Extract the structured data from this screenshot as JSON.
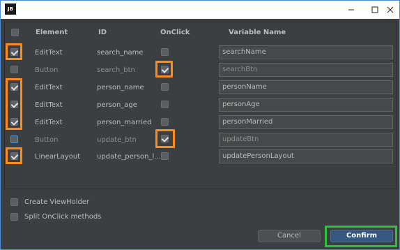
{
  "titlebar": {
    "app_icon_text": "JB",
    "minimize": "minimize",
    "maximize": "maximize",
    "close": "close"
  },
  "table": {
    "headers": {
      "element": "Element",
      "id": "ID",
      "onclick": "OnClick",
      "variable": "Variable Name"
    },
    "rows": [
      {
        "element": "EditText",
        "id": "search_name",
        "variable": "searchName",
        "checked": true,
        "onclick": false,
        "enabled": true
      },
      {
        "element": "Button",
        "id": "search_btn",
        "variable": "searchBtn",
        "checked": false,
        "onclick": true,
        "enabled": false
      },
      {
        "element": "EditText",
        "id": "person_name",
        "variable": "personName",
        "checked": true,
        "onclick": false,
        "enabled": true
      },
      {
        "element": "EditText",
        "id": "person_age",
        "variable": "personAge",
        "checked": true,
        "onclick": false,
        "enabled": true
      },
      {
        "element": "EditText",
        "id": "person_married",
        "variable": "personMarried",
        "checked": true,
        "onclick": false,
        "enabled": true
      },
      {
        "element": "Button",
        "id": "update_btn",
        "variable": "updateBtn",
        "checked": false,
        "onclick": true,
        "enabled": false
      },
      {
        "element": "LinearLayout",
        "id": "update_person_l...",
        "variable": "updatePersonLayout",
        "checked": true,
        "onclick": false,
        "enabled": true
      }
    ]
  },
  "options": {
    "create_viewholder": "Create ViewHolder",
    "split_onclick": "Split OnClick methods"
  },
  "buttons": {
    "cancel": "Cancel",
    "confirm": "Confirm"
  },
  "colors": {
    "highlight_orange": "#ff8c1a",
    "highlight_green": "#2fbf3f",
    "primary_button": "#365880",
    "dialog_bg": "#3c3f41"
  }
}
